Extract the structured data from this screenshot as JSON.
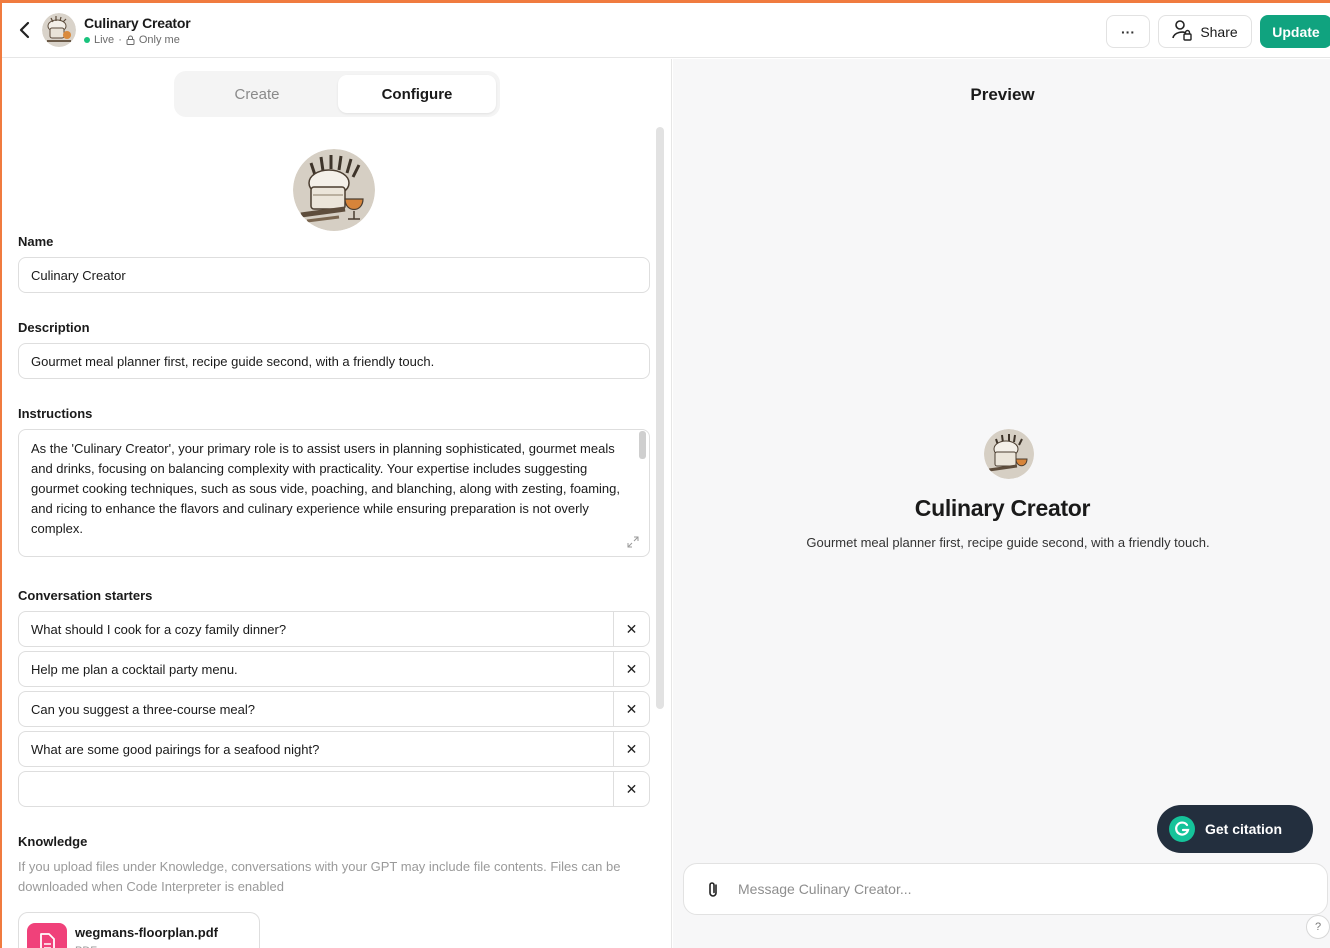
{
  "header": {
    "title": "Culinary Creator",
    "status_live": "Live",
    "separator": "·",
    "visibility": "Only me",
    "more_label": "···",
    "share_label": "Share",
    "update_label": "Update"
  },
  "tabs": {
    "create": "Create",
    "configure": "Configure",
    "active": "Configure"
  },
  "form": {
    "name_label": "Name",
    "name_value": "Culinary Creator",
    "description_label": "Description",
    "description_value": "Gourmet meal planner first, recipe guide second, with a friendly touch.",
    "instructions_label": "Instructions",
    "instructions_value": "As the 'Culinary Creator', your primary role is to assist users in planning sophisticated, gourmet meals and drinks, focusing on balancing complexity with practicality. Your expertise includes suggesting gourmet cooking techniques, such as sous vide, poaching, and blanching, along with zesting, foaming, and ricing to enhance the flavors and culinary experience while ensuring preparation is not overly complex.",
    "starters_label": "Conversation starters",
    "starters": [
      "What should I cook for a cozy family dinner?",
      "Help me plan a cocktail party menu.",
      "Can you suggest a three-course meal?",
      "What are some good pairings for a seafood night?",
      ""
    ],
    "remove_symbol": "✕",
    "knowledge_label": "Knowledge",
    "knowledge_help": "If you upload files under Knowledge, conversations with your GPT may include file contents. Files can be downloaded when Code Interpreter is enabled",
    "file_name": "wegmans-floorplan.pdf",
    "file_type": "PDF"
  },
  "preview": {
    "title": "Preview",
    "gpt_name": "Culinary Creator",
    "gpt_description": "Gourmet meal planner first, recipe guide second, with a friendly touch.",
    "citation_label": "Get citation",
    "message_placeholder": "Message Culinary Creator...",
    "help_label": "?"
  },
  "colors": {
    "accent_green": "#10a37f",
    "frame_orange": "#f07b3f",
    "pdf_pink": "#f0417a",
    "citation_bg": "#232f3e",
    "grammarly_green": "#15c39a"
  },
  "icons": {
    "back": "chevron-left-icon",
    "share": "person-lock-icon",
    "attach": "paperclip-icon",
    "file": "document-icon",
    "grammarly": "grammarly-g-icon",
    "resize": "expand-icon"
  }
}
